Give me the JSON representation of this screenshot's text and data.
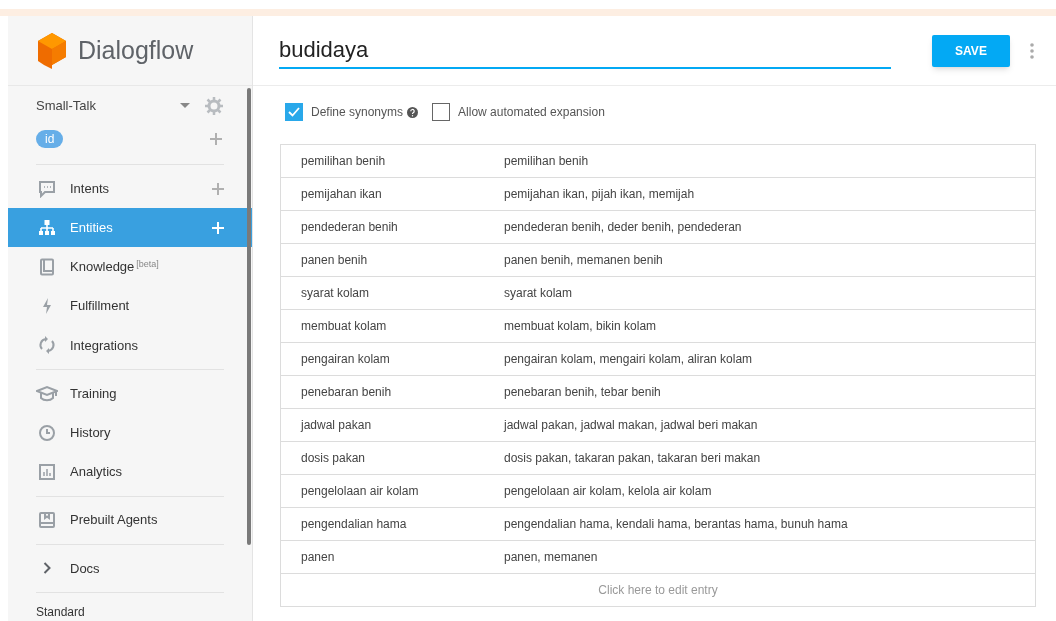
{
  "sidebar": {
    "logo": "Dialogflow",
    "agent": "Small-Talk",
    "language": "id",
    "groups": [
      [
        {
          "label": "Intents",
          "selected": false,
          "add": true
        },
        {
          "label": "Entities",
          "selected": true,
          "add": true
        },
        {
          "label": "Knowledge",
          "badge": "[beta]",
          "selected": false,
          "add": false
        },
        {
          "label": "Fulfillment",
          "selected": false,
          "add": false
        },
        {
          "label": "Integrations",
          "selected": false,
          "add": false
        }
      ],
      [
        {
          "label": "Training",
          "selected": false,
          "add": false
        },
        {
          "label": "History",
          "selected": false,
          "add": false
        },
        {
          "label": "Analytics",
          "selected": false,
          "add": false
        }
      ],
      [
        {
          "label": "Prebuilt Agents",
          "selected": false,
          "add": false
        }
      ],
      [
        {
          "label": "Docs",
          "selected": false,
          "add": false
        }
      ]
    ],
    "footer": "Standard"
  },
  "entity": {
    "name": "budidaya",
    "save": "SAVE",
    "options": [
      {
        "label": "Define synonyms",
        "checked": true,
        "help": true
      },
      {
        "label": "Allow automated expansion",
        "checked": false,
        "help": false
      }
    ],
    "rows": [
      {
        "value": "pemilihan benih",
        "synonyms": "pemilihan benih"
      },
      {
        "value": "pemijahan ikan",
        "synonyms": "pemijahan ikan, pijah ikan, memijah"
      },
      {
        "value": "pendederan benih",
        "synonyms": "pendederan benih, deder benih, pendederan"
      },
      {
        "value": "panen benih",
        "synonyms": "panen benih, memanen benih"
      },
      {
        "value": "syarat kolam",
        "synonyms": "syarat kolam"
      },
      {
        "value": "membuat kolam",
        "synonyms": "membuat kolam, bikin kolam"
      },
      {
        "value": "pengairan kolam",
        "synonyms": "pengairan kolam, mengairi kolam, aliran kolam"
      },
      {
        "value": "penebaran benih",
        "synonyms": "penebaran benih, tebar benih"
      },
      {
        "value": "jadwal pakan",
        "synonyms": "jadwal pakan, jadwal makan, jadwal beri makan"
      },
      {
        "value": "dosis pakan",
        "synonyms": "dosis pakan, takaran pakan, takaran beri makan"
      },
      {
        "value": "pengelolaan air kolam",
        "synonyms": "pengelolaan air kolam, kelola air kolam"
      },
      {
        "value": "pengendalian hama",
        "synonyms": "pengendalian hama, kendali hama, berantas hama, bunuh hama"
      },
      {
        "value": "panen",
        "synonyms": "panen, memanen"
      }
    ],
    "add_entry": "Click here to edit entry"
  }
}
